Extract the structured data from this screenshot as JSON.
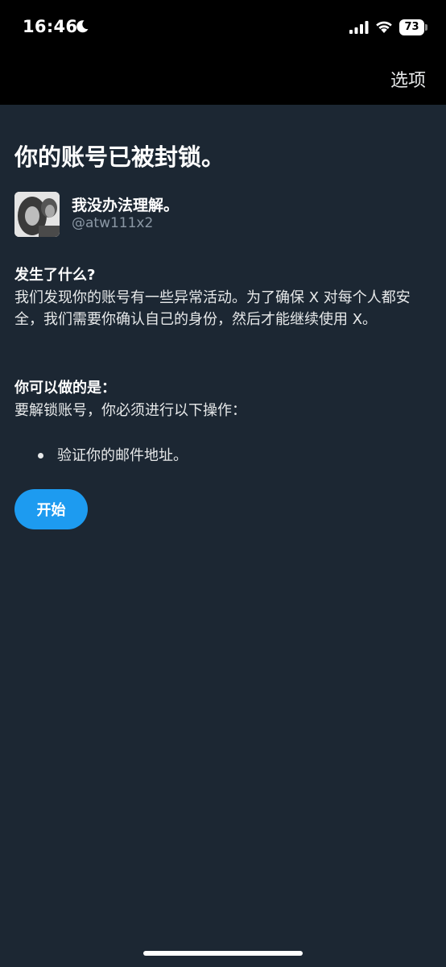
{
  "status_bar": {
    "time": "16:46",
    "battery": "73",
    "icons": [
      "moon-icon",
      "signal-icon",
      "wifi-icon",
      "battery-icon"
    ]
  },
  "nav": {
    "options_label": "选项"
  },
  "main": {
    "title": "你的账号已被封锁。",
    "account": {
      "display_name": "我没办法理解。",
      "handle": "@atw111x2"
    },
    "what_happened": {
      "heading": "发生了什么?",
      "text": "我们发现你的账号有一些异常活动。为了确保 X 对每个人都安全，我们需要你确认自己的身份，然后才能继续使用 X。"
    },
    "what_you_can_do": {
      "heading": "你可以做的是：",
      "text": "要解锁账号，你必须进行以下操作：",
      "steps": [
        "验证你的邮件地址。"
      ]
    },
    "start_button_label": "开始"
  },
  "colors": {
    "background": "#1c2733",
    "top_bar": "#000000",
    "accent": "#1d9bf0",
    "secondary_text": "#8b98a5"
  }
}
